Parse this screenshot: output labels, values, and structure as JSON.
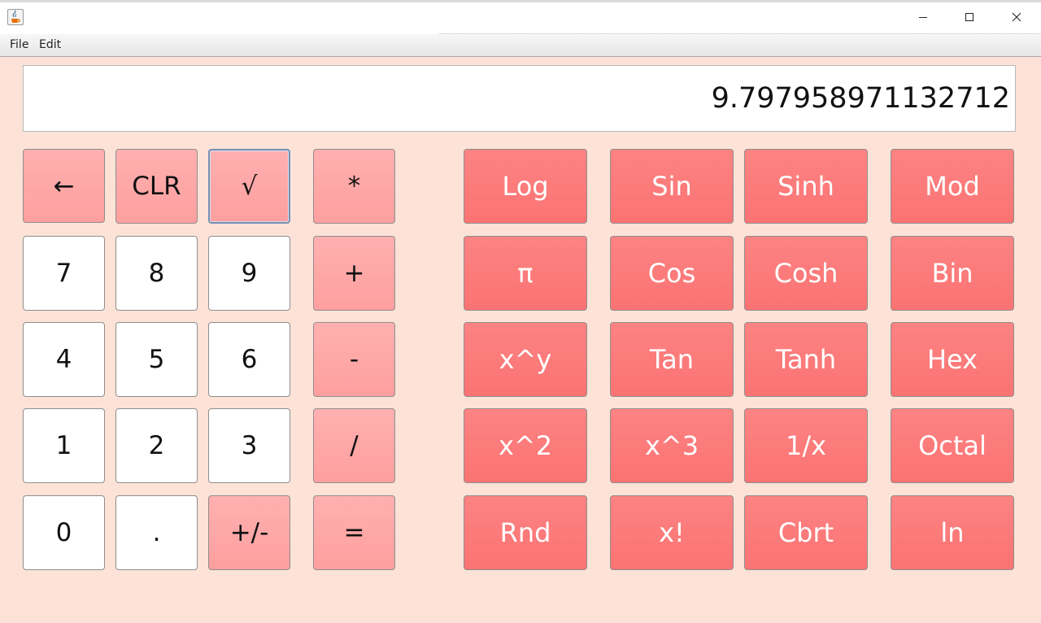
{
  "window": {
    "minimize_icon": "minimize-icon",
    "maximize_icon": "maximize-icon",
    "close_icon": "close-icon",
    "app_icon": "java-cup-icon"
  },
  "menu": {
    "file": "File",
    "edit": "Edit"
  },
  "display": {
    "value": "9.797958971132712"
  },
  "keys": {
    "back": "←",
    "clr": "CLR",
    "sqrt": "√",
    "mul": "*",
    "seven": "7",
    "eight": "8",
    "nine": "9",
    "plus": "+",
    "four": "4",
    "five": "5",
    "six": "6",
    "minus": "-",
    "one": "1",
    "two": "2",
    "three": "3",
    "div": "/",
    "zero": "0",
    "dot": ".",
    "negate": "+/-",
    "equals": "=",
    "log": "Log",
    "sin": "Sin",
    "sinh": "Sinh",
    "mod": "Mod",
    "pi": "π",
    "cos": "Cos",
    "cosh": "Cosh",
    "bin": "Bin",
    "pow": "x^y",
    "tan": "Tan",
    "tanh": "Tanh",
    "hex": "Hex",
    "square": "x^2",
    "cube": "x^3",
    "reciprocal": "1/x",
    "octal": "Octal",
    "rnd": "Rnd",
    "factorial": "x!",
    "cbrt": "Cbrt",
    "ln": "ln"
  },
  "colors": {
    "background": "#fde3d7",
    "number_key": "#ffffff",
    "operator_key": "#fea3a3",
    "scientific_key": "#fc7878",
    "scientific_text": "#ffffff"
  }
}
